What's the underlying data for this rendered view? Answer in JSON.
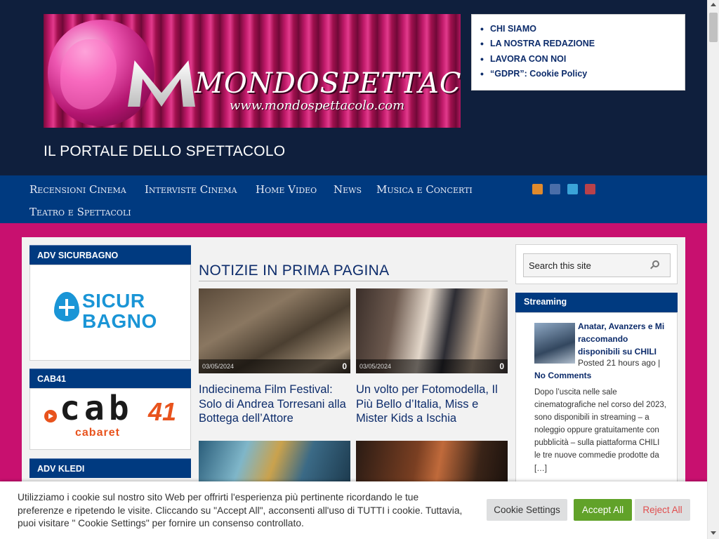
{
  "header": {
    "logo_text": "MONDOSPETTACOLO",
    "logo_url": "www.mondospettacolo.com",
    "tagline": "IL PORTALE DELLO SPETTACOLO",
    "top_links": [
      "CHI SIAMO",
      "LA NOSTRA REDAZIONE",
      "LAVORA CON NOI",
      "“GDPR”: Cookie Policy"
    ]
  },
  "nav": {
    "items": [
      "Recensioni Cinema",
      "Interviste Cinema",
      "Home Video",
      "News",
      "Musica e Concerti",
      "Teatro e Spettacoli"
    ],
    "social_icons": [
      "rss-icon",
      "facebook-icon",
      "twitter-icon",
      "youtube-icon"
    ]
  },
  "sidebar_left": {
    "widgets": [
      {
        "title": "ADV SICURBAGNO",
        "logo_text": "SICUR\nBAGNO"
      },
      {
        "title": "CAB41",
        "logo_main": "cab",
        "logo_number": "41",
        "logo_sub": "cabaret"
      },
      {
        "title": "ADV KLEDI"
      }
    ]
  },
  "main": {
    "section_title": "NOTIZIE IN PRIMA PAGINA",
    "articles": [
      {
        "date": "03/05/2024",
        "comments": "0",
        "title": "Indiecinema Film Festival: Solo di Andrea Torresani alla Bottega dell’Attore"
      },
      {
        "date": "03/05/2024",
        "comments": "0",
        "title": "Un volto per Fotomodella, Il Più Bello d’Italia, Miss e Mister Kids a Ischia"
      }
    ]
  },
  "sidebar_right": {
    "search_placeholder": "Search this site",
    "streaming": {
      "title": "Streaming",
      "post_title": "Anatar, Avanzers e Mi raccomando disponibili su CHILI",
      "posted": "Posted 21 hours ago |",
      "comments": "No Comments",
      "excerpt": "Dopo l’uscita nelle sale cinematografiche nel corso del 2023, sono disponibili in streaming – a noleggio oppure gratuitamente con pubblicità – sulla piattaforma CHILI le tre nuove commedie prodotte da […]"
    }
  },
  "cookie_banner": {
    "text": "Utilizziamo i cookie sul nostro sito Web per offrirti l'esperienza più pertinente ricordando le tue preferenze e ripetendo le visite. Cliccando su \"Accept All\", acconsenti all'uso di TUTTI i cookie. Tuttavia, puoi visitare \" Cookie Settings\" per fornire un consenso controllato.",
    "settings_label": "Cookie Settings",
    "accept_label": "Accept All",
    "reject_label": "Reject All"
  },
  "colors": {
    "header_bg": "#0f1f3d",
    "nav_bg": "#003a80",
    "page_bg": "#c8106f",
    "accept_green": "#61a229",
    "reject_red": "#e04e4e"
  }
}
